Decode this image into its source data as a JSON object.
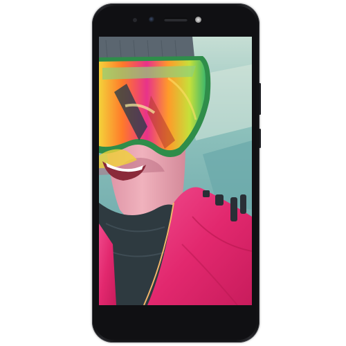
{
  "device": {
    "body_color": "#141417",
    "screen_colors": {
      "sky": "#8ec2bc",
      "jacket": "#e8327a",
      "neck_gaiter": "#2e3a40",
      "beanie": "#5b6670",
      "skin": "#e7a3b0"
    }
  }
}
